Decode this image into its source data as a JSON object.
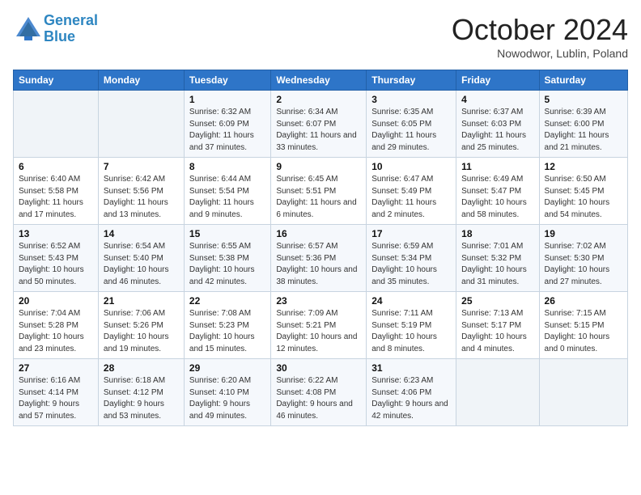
{
  "header": {
    "logo_line1": "General",
    "logo_line2": "Blue",
    "month": "October 2024",
    "location": "Nowodwor, Lublin, Poland"
  },
  "days_of_week": [
    "Sunday",
    "Monday",
    "Tuesday",
    "Wednesday",
    "Thursday",
    "Friday",
    "Saturday"
  ],
  "weeks": [
    [
      {
        "day": "",
        "sunrise": "",
        "sunset": "",
        "daylight": ""
      },
      {
        "day": "",
        "sunrise": "",
        "sunset": "",
        "daylight": ""
      },
      {
        "day": "1",
        "sunrise": "Sunrise: 6:32 AM",
        "sunset": "Sunset: 6:09 PM",
        "daylight": "Daylight: 11 hours and 37 minutes."
      },
      {
        "day": "2",
        "sunrise": "Sunrise: 6:34 AM",
        "sunset": "Sunset: 6:07 PM",
        "daylight": "Daylight: 11 hours and 33 minutes."
      },
      {
        "day": "3",
        "sunrise": "Sunrise: 6:35 AM",
        "sunset": "Sunset: 6:05 PM",
        "daylight": "Daylight: 11 hours and 29 minutes."
      },
      {
        "day": "4",
        "sunrise": "Sunrise: 6:37 AM",
        "sunset": "Sunset: 6:03 PM",
        "daylight": "Daylight: 11 hours and 25 minutes."
      },
      {
        "day": "5",
        "sunrise": "Sunrise: 6:39 AM",
        "sunset": "Sunset: 6:00 PM",
        "daylight": "Daylight: 11 hours and 21 minutes."
      }
    ],
    [
      {
        "day": "6",
        "sunrise": "Sunrise: 6:40 AM",
        "sunset": "Sunset: 5:58 PM",
        "daylight": "Daylight: 11 hours and 17 minutes."
      },
      {
        "day": "7",
        "sunrise": "Sunrise: 6:42 AM",
        "sunset": "Sunset: 5:56 PM",
        "daylight": "Daylight: 11 hours and 13 minutes."
      },
      {
        "day": "8",
        "sunrise": "Sunrise: 6:44 AM",
        "sunset": "Sunset: 5:54 PM",
        "daylight": "Daylight: 11 hours and 9 minutes."
      },
      {
        "day": "9",
        "sunrise": "Sunrise: 6:45 AM",
        "sunset": "Sunset: 5:51 PM",
        "daylight": "Daylight: 11 hours and 6 minutes."
      },
      {
        "day": "10",
        "sunrise": "Sunrise: 6:47 AM",
        "sunset": "Sunset: 5:49 PM",
        "daylight": "Daylight: 11 hours and 2 minutes."
      },
      {
        "day": "11",
        "sunrise": "Sunrise: 6:49 AM",
        "sunset": "Sunset: 5:47 PM",
        "daylight": "Daylight: 10 hours and 58 minutes."
      },
      {
        "day": "12",
        "sunrise": "Sunrise: 6:50 AM",
        "sunset": "Sunset: 5:45 PM",
        "daylight": "Daylight: 10 hours and 54 minutes."
      }
    ],
    [
      {
        "day": "13",
        "sunrise": "Sunrise: 6:52 AM",
        "sunset": "Sunset: 5:43 PM",
        "daylight": "Daylight: 10 hours and 50 minutes."
      },
      {
        "day": "14",
        "sunrise": "Sunrise: 6:54 AM",
        "sunset": "Sunset: 5:40 PM",
        "daylight": "Daylight: 10 hours and 46 minutes."
      },
      {
        "day": "15",
        "sunrise": "Sunrise: 6:55 AM",
        "sunset": "Sunset: 5:38 PM",
        "daylight": "Daylight: 10 hours and 42 minutes."
      },
      {
        "day": "16",
        "sunrise": "Sunrise: 6:57 AM",
        "sunset": "Sunset: 5:36 PM",
        "daylight": "Daylight: 10 hours and 38 minutes."
      },
      {
        "day": "17",
        "sunrise": "Sunrise: 6:59 AM",
        "sunset": "Sunset: 5:34 PM",
        "daylight": "Daylight: 10 hours and 35 minutes."
      },
      {
        "day": "18",
        "sunrise": "Sunrise: 7:01 AM",
        "sunset": "Sunset: 5:32 PM",
        "daylight": "Daylight: 10 hours and 31 minutes."
      },
      {
        "day": "19",
        "sunrise": "Sunrise: 7:02 AM",
        "sunset": "Sunset: 5:30 PM",
        "daylight": "Daylight: 10 hours and 27 minutes."
      }
    ],
    [
      {
        "day": "20",
        "sunrise": "Sunrise: 7:04 AM",
        "sunset": "Sunset: 5:28 PM",
        "daylight": "Daylight: 10 hours and 23 minutes."
      },
      {
        "day": "21",
        "sunrise": "Sunrise: 7:06 AM",
        "sunset": "Sunset: 5:26 PM",
        "daylight": "Daylight: 10 hours and 19 minutes."
      },
      {
        "day": "22",
        "sunrise": "Sunrise: 7:08 AM",
        "sunset": "Sunset: 5:23 PM",
        "daylight": "Daylight: 10 hours and 15 minutes."
      },
      {
        "day": "23",
        "sunrise": "Sunrise: 7:09 AM",
        "sunset": "Sunset: 5:21 PM",
        "daylight": "Daylight: 10 hours and 12 minutes."
      },
      {
        "day": "24",
        "sunrise": "Sunrise: 7:11 AM",
        "sunset": "Sunset: 5:19 PM",
        "daylight": "Daylight: 10 hours and 8 minutes."
      },
      {
        "day": "25",
        "sunrise": "Sunrise: 7:13 AM",
        "sunset": "Sunset: 5:17 PM",
        "daylight": "Daylight: 10 hours and 4 minutes."
      },
      {
        "day": "26",
        "sunrise": "Sunrise: 7:15 AM",
        "sunset": "Sunset: 5:15 PM",
        "daylight": "Daylight: 10 hours and 0 minutes."
      }
    ],
    [
      {
        "day": "27",
        "sunrise": "Sunrise: 6:16 AM",
        "sunset": "Sunset: 4:14 PM",
        "daylight": "Daylight: 9 hours and 57 minutes."
      },
      {
        "day": "28",
        "sunrise": "Sunrise: 6:18 AM",
        "sunset": "Sunset: 4:12 PM",
        "daylight": "Daylight: 9 hours and 53 minutes."
      },
      {
        "day": "29",
        "sunrise": "Sunrise: 6:20 AM",
        "sunset": "Sunset: 4:10 PM",
        "daylight": "Daylight: 9 hours and 49 minutes."
      },
      {
        "day": "30",
        "sunrise": "Sunrise: 6:22 AM",
        "sunset": "Sunset: 4:08 PM",
        "daylight": "Daylight: 9 hours and 46 minutes."
      },
      {
        "day": "31",
        "sunrise": "Sunrise: 6:23 AM",
        "sunset": "Sunset: 4:06 PM",
        "daylight": "Daylight: 9 hours and 42 minutes."
      },
      {
        "day": "",
        "sunrise": "",
        "sunset": "",
        "daylight": ""
      },
      {
        "day": "",
        "sunrise": "",
        "sunset": "",
        "daylight": ""
      }
    ]
  ]
}
